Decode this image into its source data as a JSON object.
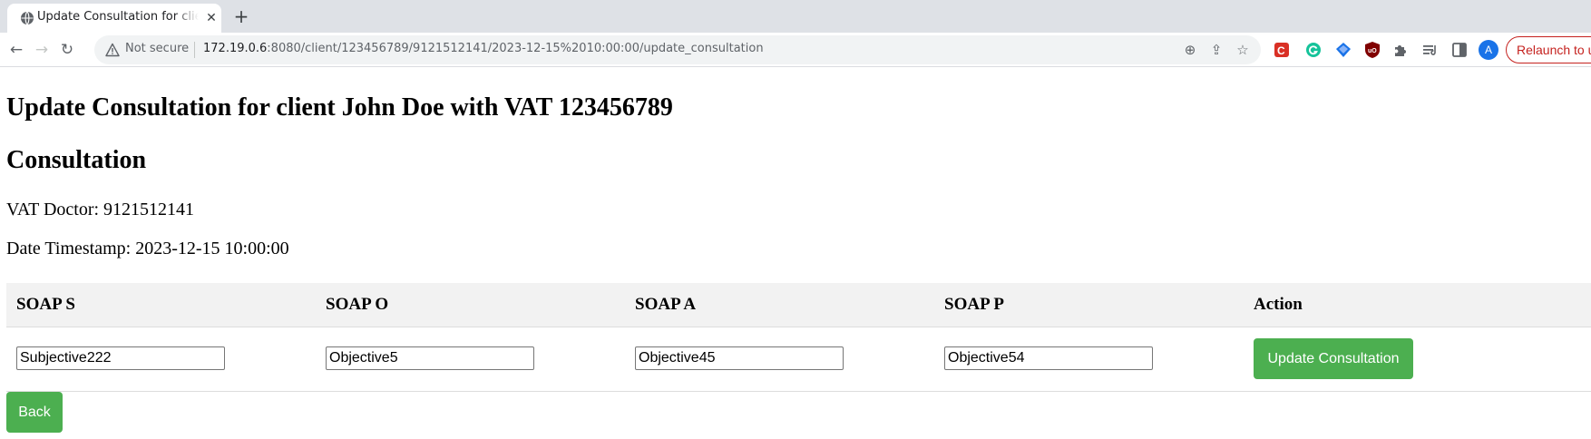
{
  "browser": {
    "tab_title": "Update Consultation for client John Doe with VAT 123456789",
    "tab_close": "✕",
    "new_tab": "+",
    "security_label": "Not secure",
    "url_host": "172.19.0.6",
    "url_rest": ":8080/client/123456789/9121512141/2023-12-15%2010:00:00/update_consultation",
    "profile_initial": "A",
    "relaunch_label": "Relaunch to update",
    "icons": {
      "back": "back-arrow-icon",
      "forward": "forward-arrow-icon",
      "reload": "reload-icon",
      "zoom": "zoom-icon",
      "share": "share-icon",
      "bookmark": "star-icon"
    }
  },
  "page": {
    "title": "Update Consultation for client John Doe with VAT 123456789",
    "section_title": "Consultation",
    "vat_doctor": "VAT Doctor: 9121512141",
    "date_timestamp": "Date Timestamp: 2023-12-15 10:00:00"
  },
  "table": {
    "headers": [
      "SOAP S",
      "SOAP O",
      "SOAP A",
      "SOAP P",
      "Action"
    ],
    "row": {
      "soap_s": "Subjective222",
      "soap_o": "Objective5",
      "soap_a": "Objective45",
      "soap_p": "Objective54"
    },
    "update_button": "Update Consultation"
  },
  "back_button": "Back",
  "colors": {
    "button_green": "#4caf50",
    "header_bg": "#f2f2f2",
    "relaunch_red": "#c5221f",
    "avatar_blue": "#1a73e8"
  }
}
